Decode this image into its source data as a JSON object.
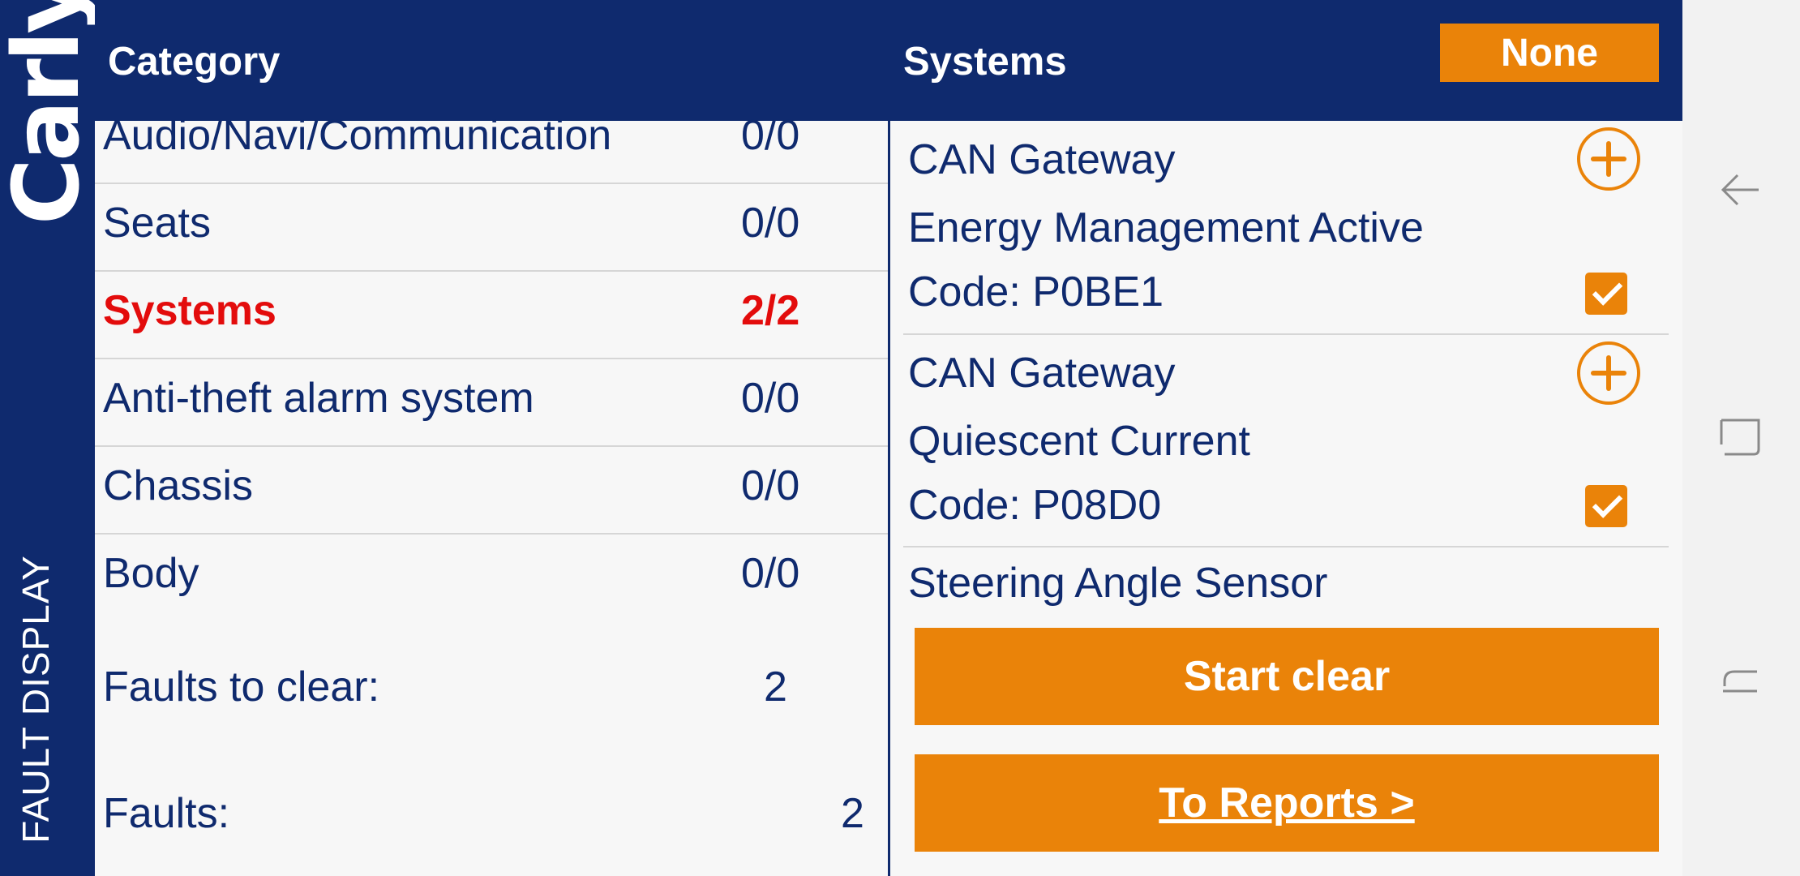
{
  "sidebar": {
    "logo_text": "Carly",
    "section_label": "FAULT DISPLAY"
  },
  "header": {
    "category_title": "Category",
    "systems_title": "Systems",
    "filter_button": "None"
  },
  "categories": [
    {
      "name": "Audio/Navi/Communication",
      "count": "0/0"
    },
    {
      "name": "Seats",
      "count": "0/0"
    },
    {
      "name": "Systems",
      "count": "2/2",
      "active": true
    },
    {
      "name": "Anti-theft alarm system",
      "count": "0/0"
    },
    {
      "name": "Chassis",
      "count": "0/0"
    },
    {
      "name": "Body",
      "count": "0/0"
    }
  ],
  "summary": {
    "faults_to_clear_label": "Faults to clear:",
    "faults_to_clear_value": "2",
    "faults_label": "Faults:",
    "faults_value": "2"
  },
  "systems": {
    "faults": [
      {
        "module": "CAN Gateway",
        "description": "Energy Management Active",
        "code": "Code:  P0BE1",
        "checked": true
      },
      {
        "module": "CAN Gateway",
        "description": "Quiescent Current",
        "code": "Code:  P08D0",
        "checked": true
      }
    ],
    "next_module": "Steering Angle Sensor",
    "start_clear_button": "Start clear",
    "reports_button": "To Reports >"
  },
  "colors": {
    "primary": "#0f2a6e",
    "accent": "#ea8309",
    "active": "#e30c0c",
    "background": "#f7f7f7"
  },
  "icons": {
    "expand": "plus-circle-icon",
    "selected": "checkbox-checked-icon",
    "nav_back": "back-arrow-icon",
    "nav_home": "home-square-icon",
    "nav_recent": "recent-apps-icon"
  }
}
